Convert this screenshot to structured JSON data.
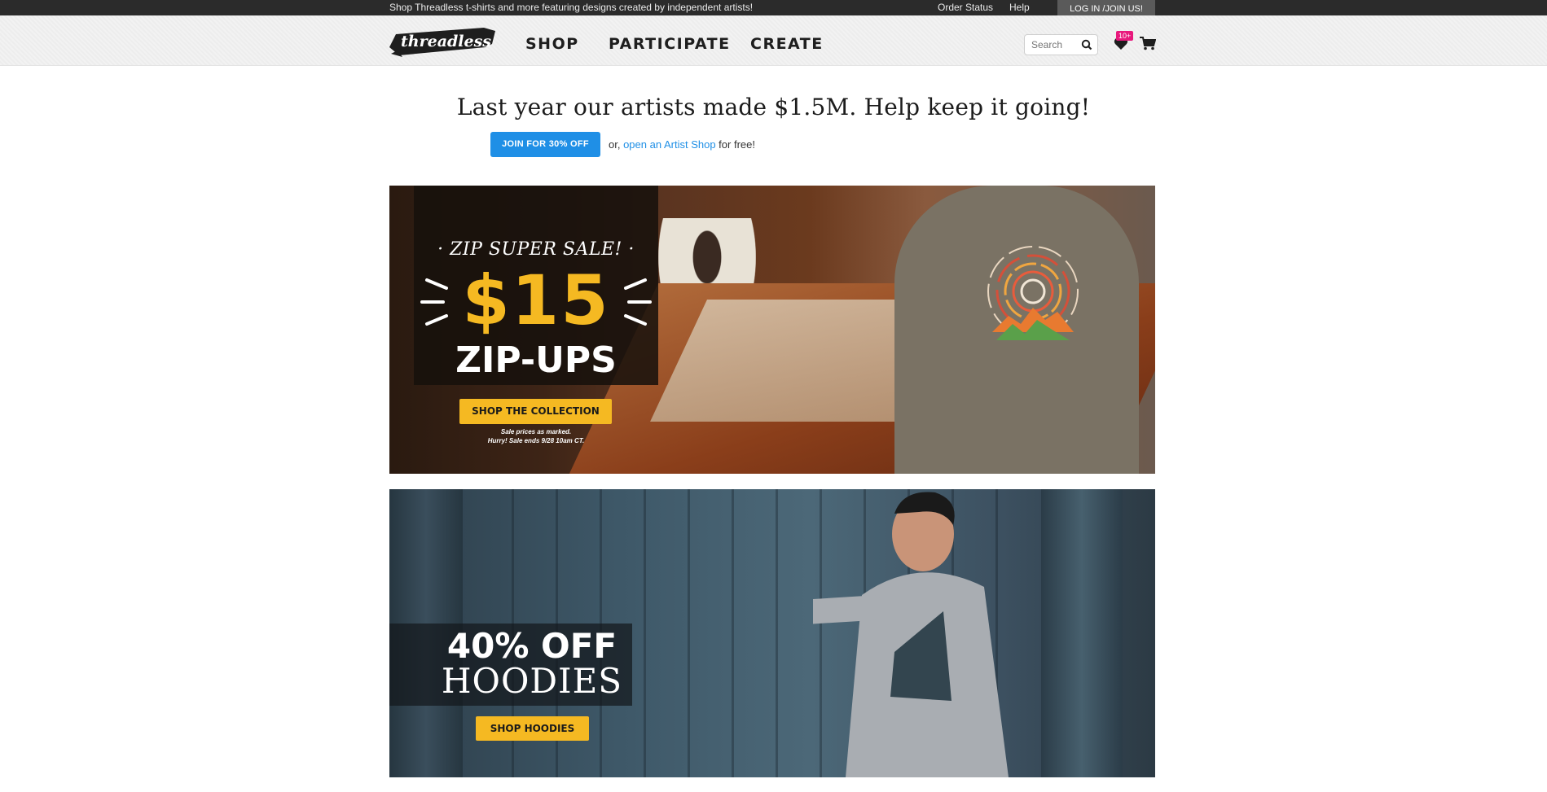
{
  "utility_bar": {
    "tagline": "Shop Threadless t-shirts and more featuring designs created by independent artists!",
    "order_status": "Order Status",
    "help": "Help",
    "login": "LOG IN /JOIN US!"
  },
  "header": {
    "logo_text": "threadless",
    "nav": [
      "SHOP",
      "PARTICIPATE",
      "CREATE"
    ],
    "search_placeholder": "Search",
    "wishlist_badge": "10+",
    "icons": {
      "search": "search-icon",
      "wishlist": "heart-icon",
      "cart": "cart-icon"
    }
  },
  "promo": {
    "headline": "Last year our artists made $1.5M. Help keep it going!",
    "join_button": "JOIN FOR 30% OFF",
    "or": "or, ",
    "artist_shop_link": "open an Artist Shop",
    "for_free": " for free!"
  },
  "banner1": {
    "eyebrow": "· ZIP SUPER SALE! ·",
    "price": "$15",
    "product": "ZIP-UPS",
    "button": "SHOP THE COLLECTION",
    "fine_print_1": "Sale prices as marked.",
    "fine_print_2": "Hurry! Sale ends 9/28 10am CT."
  },
  "banner2": {
    "discount": "40% OFF",
    "product": "HOODIES",
    "button": "SHOP HOODIES"
  },
  "colors": {
    "accent_blue": "#1f8fe6",
    "sale_yellow": "#f5b922",
    "badge_pink": "#e8197d",
    "topbar": "#2b2b2b"
  }
}
